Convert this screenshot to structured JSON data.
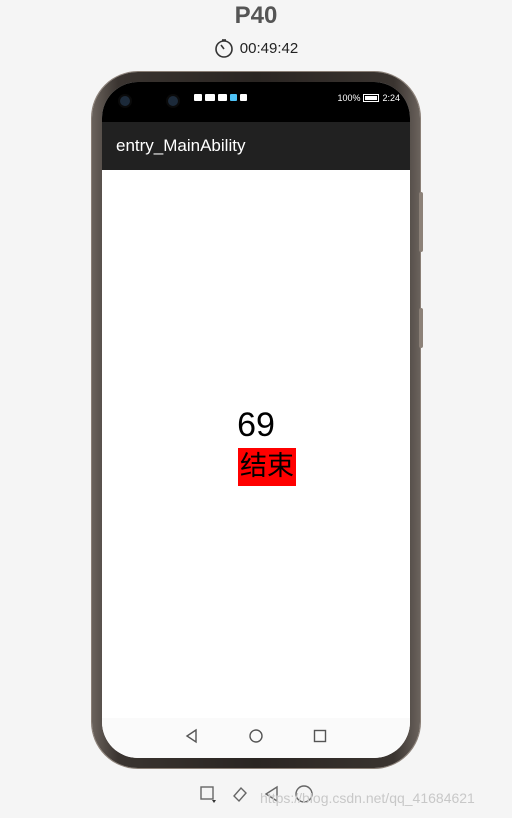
{
  "device": {
    "name": "P40",
    "timer": "00:49:42"
  },
  "status_bar": {
    "battery": "100%",
    "time": "2:24"
  },
  "app_bar": {
    "title": "entry_MainAbility"
  },
  "main": {
    "counter": "69",
    "end_button_label": "结束"
  },
  "footer": {
    "watermark": "https://blog.csdn.net/qq_41684621"
  },
  "colors": {
    "app_bar": "#212121",
    "end_button_bg": "#ff0000",
    "background": "#f5f5f5"
  },
  "icons": [
    "timer-icon",
    "back-icon",
    "home-icon",
    "recent-icon",
    "rotate-icon",
    "eraser-icon"
  ]
}
